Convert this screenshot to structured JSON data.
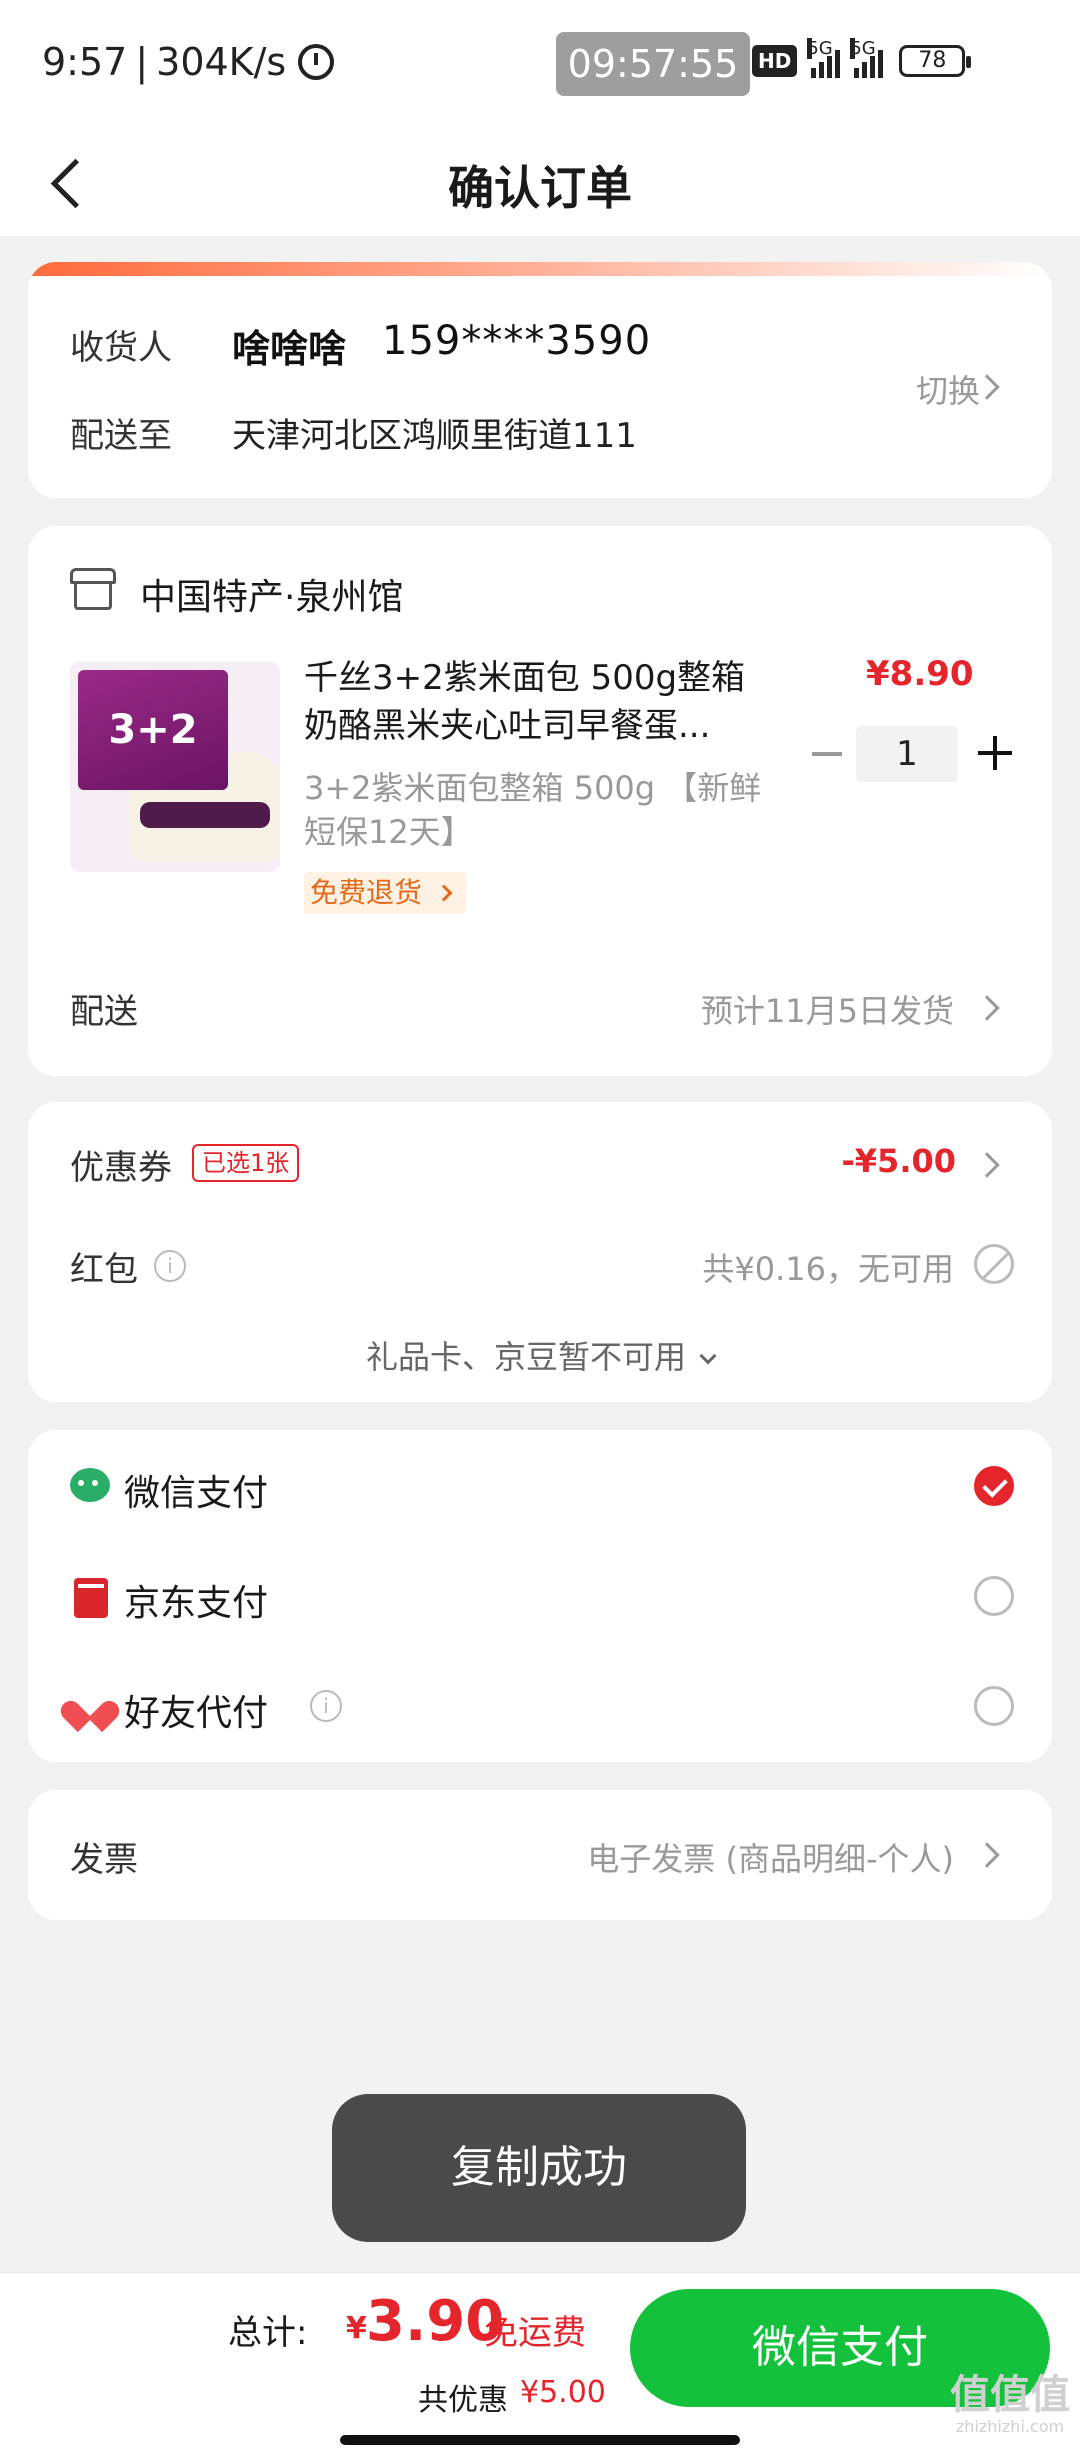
{
  "status_bar": {
    "time": "9:57",
    "speed": "304K/s",
    "clock": "09:57:55",
    "hd": "HD",
    "net1": "5G",
    "net2": "5G",
    "battery": "78"
  },
  "header": {
    "title": "确认订单"
  },
  "address": {
    "recipient_label": "收货人",
    "name": "啥啥啥",
    "phone": "159****3590",
    "ship_to_label": "配送至",
    "address": "天津河北区鸿顺里街道111",
    "switch_label": "切换"
  },
  "product_card": {
    "shop_name": "中国特产·泉州馆",
    "image_text": "3+2",
    "title": "千丝3+2紫米面包 500g整箱奶酪黑米夹心吐司早餐蛋...",
    "spec": "3+2紫米面包整箱 500g 【新鲜短保12天】",
    "tag": "免费退货",
    "price": "¥8.90",
    "quantity": "1",
    "shipping_label": "配送",
    "shipping_value": "预计11月5日发货"
  },
  "discounts": {
    "coupon_label": "优惠券",
    "coupon_badge": "已选1张",
    "coupon_value": "-¥5.00",
    "redpacket_label": "红包",
    "redpacket_value": "共¥0.16，无可用",
    "gift_note": "礼品卡、京豆暂不可用"
  },
  "payment_methods": [
    {
      "label": "微信支付",
      "icon": "wechat-pay-icon",
      "selected": true
    },
    {
      "label": "京东支付",
      "icon": "jd-pay-icon",
      "selected": false
    },
    {
      "label": "好友代付",
      "icon": "friend-pay-icon",
      "selected": false
    }
  ],
  "invoice": {
    "label": "发票",
    "value": "电子发票 (商品明细-个人)"
  },
  "toast": {
    "text": "复制成功"
  },
  "bottom_bar": {
    "total_label": "总计:",
    "currency": "¥",
    "total_value": "3.90",
    "free_shipping": "免运费",
    "savings_label": "共优惠",
    "savings_value": "¥5.00",
    "pay_button": "微信支付",
    "watermark": "值值值",
    "watermark_url": "zhizhizhi.com"
  },
  "colors": {
    "accent_red": "#e5252c",
    "pay_green": "#14c13c",
    "wechat_green": "#2aae67"
  }
}
